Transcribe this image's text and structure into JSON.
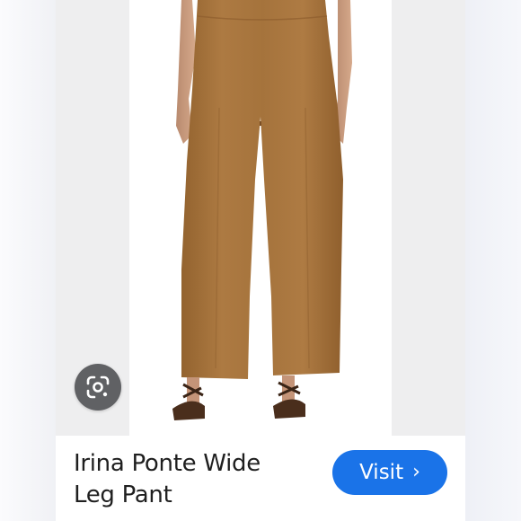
{
  "product": {
    "title_line1": "Irina Ponte Wide",
    "title_line2": "Leg Pant",
    "image_alt": "Camel wide leg pants worn with strappy heels"
  },
  "actions": {
    "visit_label": "Visit",
    "visit_chevron": "›",
    "lens_icon": "google-lens-icon"
  },
  "colors": {
    "accent": "#1a73e8",
    "pant": "#a8753f",
    "lens_bg": "#606164"
  }
}
